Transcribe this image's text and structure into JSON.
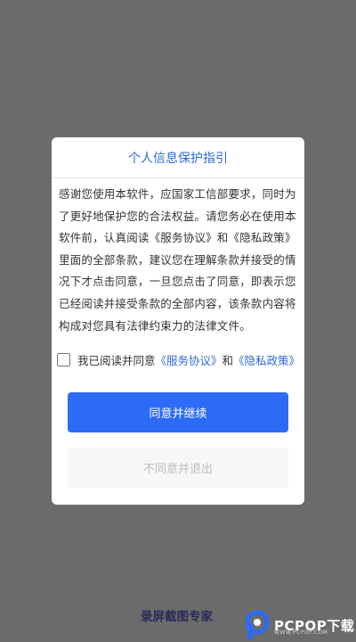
{
  "dialog": {
    "title": "个人信息保护指引",
    "body": "感谢您使用本软件，应国家工信部要求，同时为了更好地保护您的合法权益。请您务必在使用本软件前，认真阅读《服务协议》和《隐私政策》里面的全部条款，建议您在理解条款并接受的情况下才点击同意，一旦您点击了同意，即表示您已经阅读并接受条款的全部内容，该条款内容将构成对您具有法律约束力的法律文件。",
    "agree_prefix": "我已阅读并同意",
    "service_link": "《服务协议》",
    "and": "和",
    "privacy_link": "《隐私政策》",
    "agree_button": "同意并继续",
    "disagree_button": "不同意并退出"
  },
  "footer": {
    "app_name": "录屏截图专家",
    "watermark_text": "PCPOP下载",
    "watermark_sub": "WWW.PCPOP.COM"
  },
  "colors": {
    "accent": "#2d6bf6",
    "link": "#2f6bd8",
    "overlay": "#6b6b6b"
  }
}
